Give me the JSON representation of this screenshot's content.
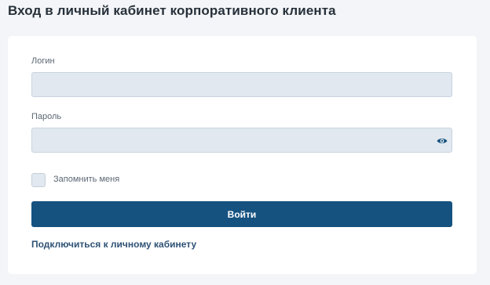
{
  "page": {
    "title": "Вход в личный кабинет корпоративного клиента"
  },
  "form": {
    "login_label": "Логин",
    "login_value": "",
    "password_label": "Пароль",
    "password_value": "",
    "remember_label": "Запомнить меня",
    "remember_checked": false,
    "submit_label": "Войти",
    "connect_link": "Подключиться к личному кабинету"
  },
  "icons": {
    "password_toggle": "eye-icon"
  },
  "colors": {
    "background": "#f3f5f8",
    "card": "#ffffff",
    "input_fill": "#e1e8ef",
    "input_border": "#c9d4de",
    "primary_button": "#155280",
    "link": "#2e5275",
    "eye_icon": "#155280"
  }
}
